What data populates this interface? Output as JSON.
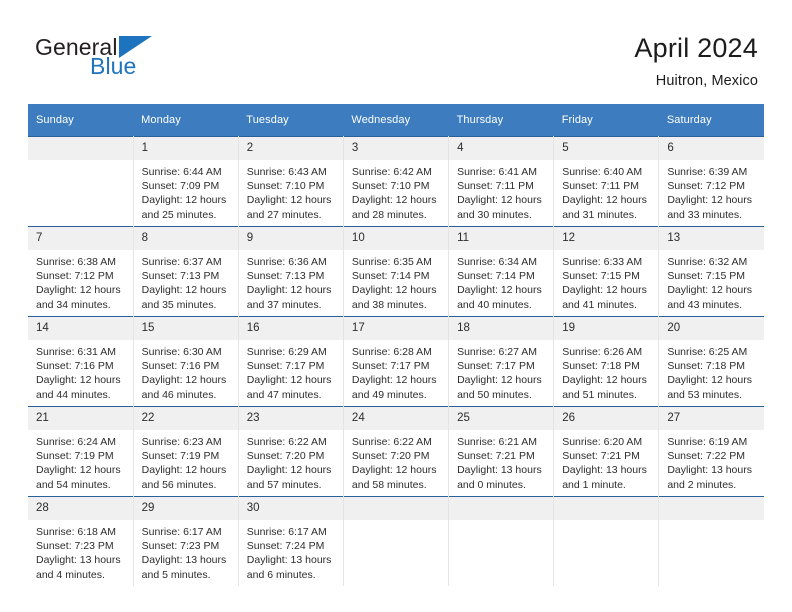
{
  "brand": {
    "name_part1": "General",
    "name_part2": "Blue",
    "logo_icon": "triangle-logo-icon"
  },
  "header": {
    "title": "April 2024",
    "subtitle": "Huitron, Mexico"
  },
  "theme": {
    "header_blue": "#3c7cbf",
    "row_divider_blue": "#2a6099",
    "daynum_band": "#f0f0f0",
    "brand_blue": "#1e73be",
    "text": "#2d2d2d"
  },
  "weekday_headers": [
    "Sunday",
    "Monday",
    "Tuesday",
    "Wednesday",
    "Thursday",
    "Friday",
    "Saturday"
  ],
  "labels": {
    "sunrise_prefix": "Sunrise:",
    "sunset_prefix": "Sunset:",
    "daylight_prefix": "Daylight:"
  },
  "weeks": [
    [
      {
        "day": "",
        "sunrise": "",
        "sunset": "",
        "daylight_line1": "",
        "daylight_line2": "",
        "empty": true
      },
      {
        "day": "1",
        "sunrise": "Sunrise: 6:44 AM",
        "sunset": "Sunset: 7:09 PM",
        "daylight_line1": "Daylight: 12 hours",
        "daylight_line2": "and 25 minutes.",
        "empty": false
      },
      {
        "day": "2",
        "sunrise": "Sunrise: 6:43 AM",
        "sunset": "Sunset: 7:10 PM",
        "daylight_line1": "Daylight: 12 hours",
        "daylight_line2": "and 27 minutes.",
        "empty": false
      },
      {
        "day": "3",
        "sunrise": "Sunrise: 6:42 AM",
        "sunset": "Sunset: 7:10 PM",
        "daylight_line1": "Daylight: 12 hours",
        "daylight_line2": "and 28 minutes.",
        "empty": false
      },
      {
        "day": "4",
        "sunrise": "Sunrise: 6:41 AM",
        "sunset": "Sunset: 7:11 PM",
        "daylight_line1": "Daylight: 12 hours",
        "daylight_line2": "and 30 minutes.",
        "empty": false
      },
      {
        "day": "5",
        "sunrise": "Sunrise: 6:40 AM",
        "sunset": "Sunset: 7:11 PM",
        "daylight_line1": "Daylight: 12 hours",
        "daylight_line2": "and 31 minutes.",
        "empty": false
      },
      {
        "day": "6",
        "sunrise": "Sunrise: 6:39 AM",
        "sunset": "Sunset: 7:12 PM",
        "daylight_line1": "Daylight: 12 hours",
        "daylight_line2": "and 33 minutes.",
        "empty": false
      }
    ],
    [
      {
        "day": "7",
        "sunrise": "Sunrise: 6:38 AM",
        "sunset": "Sunset: 7:12 PM",
        "daylight_line1": "Daylight: 12 hours",
        "daylight_line2": "and 34 minutes.",
        "empty": false
      },
      {
        "day": "8",
        "sunrise": "Sunrise: 6:37 AM",
        "sunset": "Sunset: 7:13 PM",
        "daylight_line1": "Daylight: 12 hours",
        "daylight_line2": "and 35 minutes.",
        "empty": false
      },
      {
        "day": "9",
        "sunrise": "Sunrise: 6:36 AM",
        "sunset": "Sunset: 7:13 PM",
        "daylight_line1": "Daylight: 12 hours",
        "daylight_line2": "and 37 minutes.",
        "empty": false
      },
      {
        "day": "10",
        "sunrise": "Sunrise: 6:35 AM",
        "sunset": "Sunset: 7:14 PM",
        "daylight_line1": "Daylight: 12 hours",
        "daylight_line2": "and 38 minutes.",
        "empty": false
      },
      {
        "day": "11",
        "sunrise": "Sunrise: 6:34 AM",
        "sunset": "Sunset: 7:14 PM",
        "daylight_line1": "Daylight: 12 hours",
        "daylight_line2": "and 40 minutes.",
        "empty": false
      },
      {
        "day": "12",
        "sunrise": "Sunrise: 6:33 AM",
        "sunset": "Sunset: 7:15 PM",
        "daylight_line1": "Daylight: 12 hours",
        "daylight_line2": "and 41 minutes.",
        "empty": false
      },
      {
        "day": "13",
        "sunrise": "Sunrise: 6:32 AM",
        "sunset": "Sunset: 7:15 PM",
        "daylight_line1": "Daylight: 12 hours",
        "daylight_line2": "and 43 minutes.",
        "empty": false
      }
    ],
    [
      {
        "day": "14",
        "sunrise": "Sunrise: 6:31 AM",
        "sunset": "Sunset: 7:16 PM",
        "daylight_line1": "Daylight: 12 hours",
        "daylight_line2": "and 44 minutes.",
        "empty": false
      },
      {
        "day": "15",
        "sunrise": "Sunrise: 6:30 AM",
        "sunset": "Sunset: 7:16 PM",
        "daylight_line1": "Daylight: 12 hours",
        "daylight_line2": "and 46 minutes.",
        "empty": false
      },
      {
        "day": "16",
        "sunrise": "Sunrise: 6:29 AM",
        "sunset": "Sunset: 7:17 PM",
        "daylight_line1": "Daylight: 12 hours",
        "daylight_line2": "and 47 minutes.",
        "empty": false
      },
      {
        "day": "17",
        "sunrise": "Sunrise: 6:28 AM",
        "sunset": "Sunset: 7:17 PM",
        "daylight_line1": "Daylight: 12 hours",
        "daylight_line2": "and 49 minutes.",
        "empty": false
      },
      {
        "day": "18",
        "sunrise": "Sunrise: 6:27 AM",
        "sunset": "Sunset: 7:17 PM",
        "daylight_line1": "Daylight: 12 hours",
        "daylight_line2": "and 50 minutes.",
        "empty": false
      },
      {
        "day": "19",
        "sunrise": "Sunrise: 6:26 AM",
        "sunset": "Sunset: 7:18 PM",
        "daylight_line1": "Daylight: 12 hours",
        "daylight_line2": "and 51 minutes.",
        "empty": false
      },
      {
        "day": "20",
        "sunrise": "Sunrise: 6:25 AM",
        "sunset": "Sunset: 7:18 PM",
        "daylight_line1": "Daylight: 12 hours",
        "daylight_line2": "and 53 minutes.",
        "empty": false
      }
    ],
    [
      {
        "day": "21",
        "sunrise": "Sunrise: 6:24 AM",
        "sunset": "Sunset: 7:19 PM",
        "daylight_line1": "Daylight: 12 hours",
        "daylight_line2": "and 54 minutes.",
        "empty": false
      },
      {
        "day": "22",
        "sunrise": "Sunrise: 6:23 AM",
        "sunset": "Sunset: 7:19 PM",
        "daylight_line1": "Daylight: 12 hours",
        "daylight_line2": "and 56 minutes.",
        "empty": false
      },
      {
        "day": "23",
        "sunrise": "Sunrise: 6:22 AM",
        "sunset": "Sunset: 7:20 PM",
        "daylight_line1": "Daylight: 12 hours",
        "daylight_line2": "and 57 minutes.",
        "empty": false
      },
      {
        "day": "24",
        "sunrise": "Sunrise: 6:22 AM",
        "sunset": "Sunset: 7:20 PM",
        "daylight_line1": "Daylight: 12 hours",
        "daylight_line2": "and 58 minutes.",
        "empty": false
      },
      {
        "day": "25",
        "sunrise": "Sunrise: 6:21 AM",
        "sunset": "Sunset: 7:21 PM",
        "daylight_line1": "Daylight: 13 hours",
        "daylight_line2": "and 0 minutes.",
        "empty": false
      },
      {
        "day": "26",
        "sunrise": "Sunrise: 6:20 AM",
        "sunset": "Sunset: 7:21 PM",
        "daylight_line1": "Daylight: 13 hours",
        "daylight_line2": "and 1 minute.",
        "empty": false
      },
      {
        "day": "27",
        "sunrise": "Sunrise: 6:19 AM",
        "sunset": "Sunset: 7:22 PM",
        "daylight_line1": "Daylight: 13 hours",
        "daylight_line2": "and 2 minutes.",
        "empty": false
      }
    ],
    [
      {
        "day": "28",
        "sunrise": "Sunrise: 6:18 AM",
        "sunset": "Sunset: 7:23 PM",
        "daylight_line1": "Daylight: 13 hours",
        "daylight_line2": "and 4 minutes.",
        "empty": false
      },
      {
        "day": "29",
        "sunrise": "Sunrise: 6:17 AM",
        "sunset": "Sunset: 7:23 PM",
        "daylight_line1": "Daylight: 13 hours",
        "daylight_line2": "and 5 minutes.",
        "empty": false
      },
      {
        "day": "30",
        "sunrise": "Sunrise: 6:17 AM",
        "sunset": "Sunset: 7:24 PM",
        "daylight_line1": "Daylight: 13 hours",
        "daylight_line2": "and 6 minutes.",
        "empty": false
      },
      {
        "day": "",
        "sunrise": "",
        "sunset": "",
        "daylight_line1": "",
        "daylight_line2": "",
        "empty": true
      },
      {
        "day": "",
        "sunrise": "",
        "sunset": "",
        "daylight_line1": "",
        "daylight_line2": "",
        "empty": true
      },
      {
        "day": "",
        "sunrise": "",
        "sunset": "",
        "daylight_line1": "",
        "daylight_line2": "",
        "empty": true
      },
      {
        "day": "",
        "sunrise": "",
        "sunset": "",
        "daylight_line1": "",
        "daylight_line2": "",
        "empty": true
      }
    ]
  ]
}
